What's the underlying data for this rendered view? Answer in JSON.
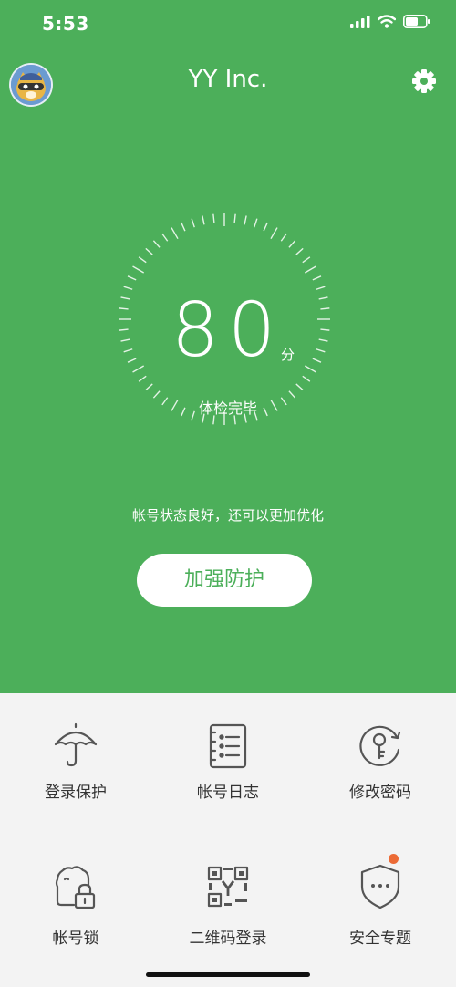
{
  "status_bar": {
    "time": "5:53",
    "icons": [
      "signal-icon",
      "wifi-icon",
      "battery-icon"
    ]
  },
  "header": {
    "title": "YY Inc.",
    "avatar": "avatar",
    "settings_icon": "gear-icon"
  },
  "score": {
    "value": "80",
    "unit": "分",
    "label": "体检完毕"
  },
  "status_message": "帐号状态良好，还可以更加优化",
  "enhance_button": "加强防护",
  "menu": [
    {
      "label": "登录保护",
      "icon": "umbrella-icon"
    },
    {
      "label": "帐号日志",
      "icon": "log-list-icon"
    },
    {
      "label": "修改密码",
      "icon": "key-refresh-icon"
    },
    {
      "label": "帐号锁",
      "icon": "account-lock-icon"
    },
    {
      "label": "二维码登录",
      "icon": "qr-code-icon"
    },
    {
      "label": "安全专题",
      "icon": "shield-icon",
      "badge": "notification-dot"
    }
  ],
  "colors": {
    "primary": "#4caf5a",
    "background": "#f3f3f3",
    "badge": "#ec6b36",
    "icon": "#555555"
  }
}
